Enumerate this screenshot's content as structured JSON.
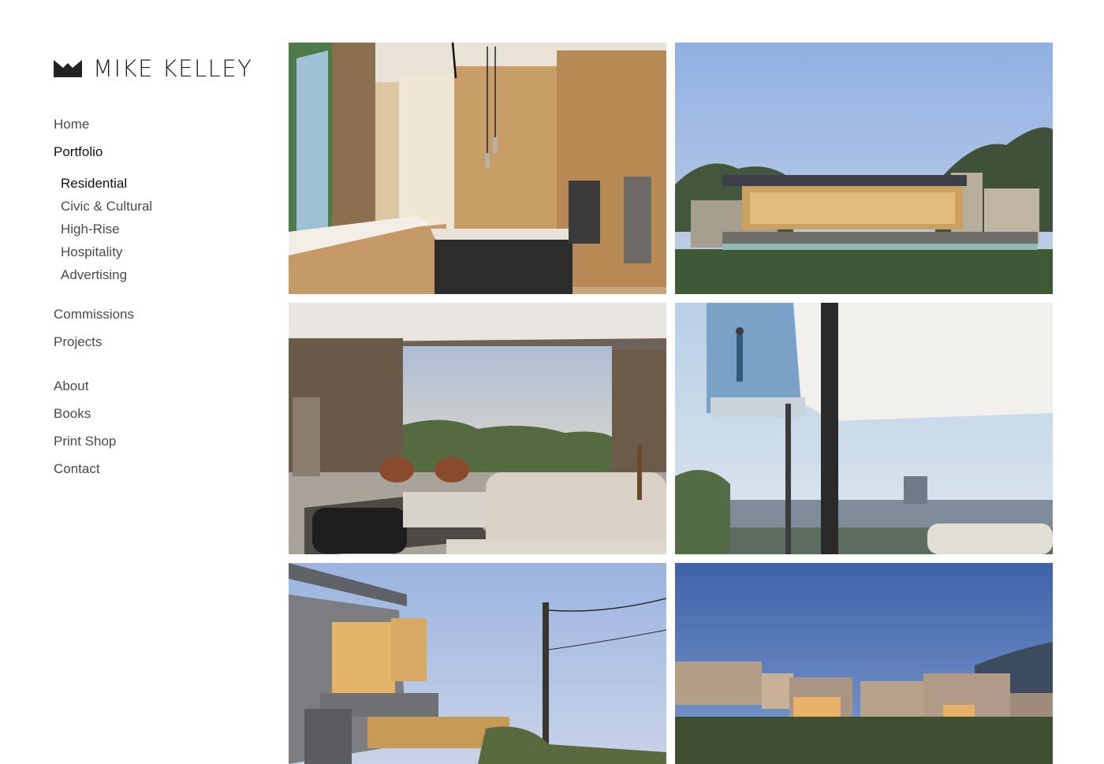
{
  "brand": {
    "name": "MIKE KELLEY",
    "logo_icon": "mountain-logo-icon"
  },
  "nav": {
    "home": "Home",
    "portfolio": "Portfolio",
    "portfolio_sub": {
      "residential": "Residential",
      "civic": "Civic & Cultural",
      "highrise": "High-Rise",
      "hospitality": "Hospitality",
      "advertising": "Advertising"
    },
    "commissions": "Commissions",
    "projects": "Projects",
    "about": "About",
    "books": "Books",
    "print_shop": "Print Shop",
    "contact": "Contact",
    "active": "Residential"
  },
  "colors": {
    "text": "#4a4a4a",
    "active_text": "#111111",
    "background": "#ffffff"
  },
  "gallery": {
    "photos": [
      {
        "subject": "modern wood kitchen with pendant lights"
      },
      {
        "subject": "low house at dusk with lawn"
      },
      {
        "subject": "living room with city view"
      },
      {
        "subject": "glass balcony overlooking city"
      },
      {
        "subject": "concrete hillside house with utility pole"
      },
      {
        "subject": "wooden barn-like houses at dusk"
      }
    ]
  }
}
